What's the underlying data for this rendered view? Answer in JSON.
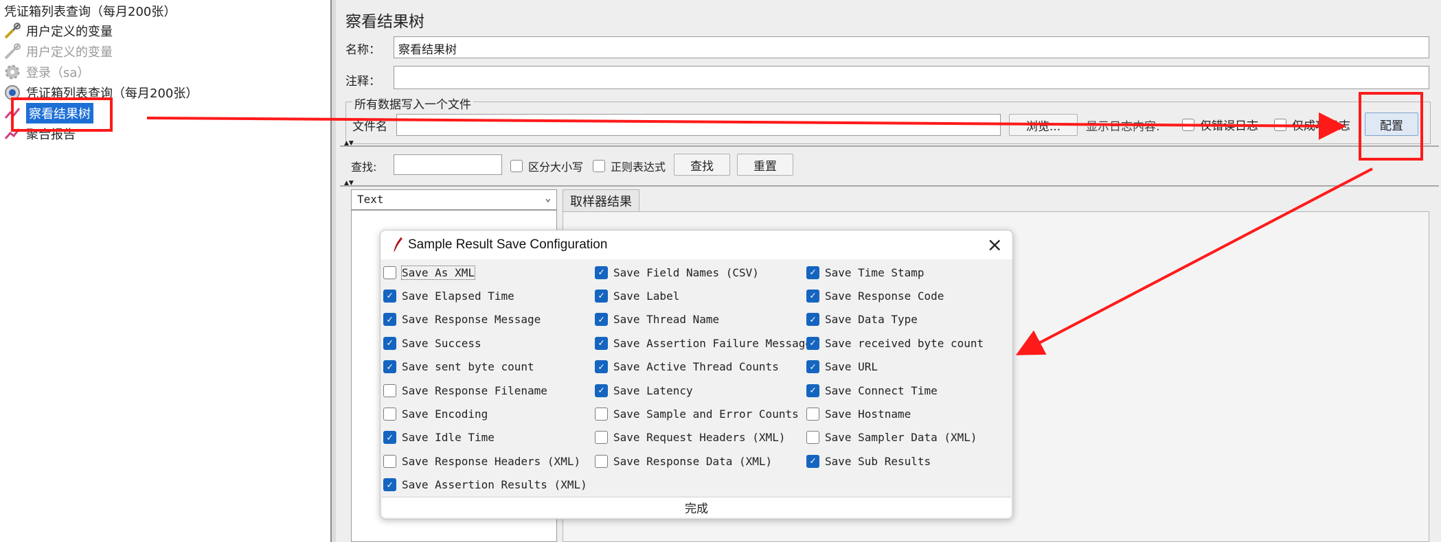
{
  "tree": {
    "items": [
      {
        "label": "凭证箱列表查询（每月200张）",
        "icon": "thread-group-icon",
        "disabled": false,
        "selected": false
      },
      {
        "label": "用户定义的变量",
        "icon": "wrench-icon",
        "disabled": false,
        "selected": false
      },
      {
        "label": "用户定义的变量",
        "icon": "wrench-icon",
        "disabled": true,
        "selected": false
      },
      {
        "label": "登录（sa）",
        "icon": "gear-icon",
        "disabled": true,
        "selected": false
      },
      {
        "label": "凭证箱列表查询（每月200张）",
        "icon": "sampler-icon",
        "disabled": false,
        "selected": false
      },
      {
        "label": "察看结果树",
        "icon": "listener-icon",
        "disabled": false,
        "selected": true
      },
      {
        "label": "聚合报告",
        "icon": "listener-icon",
        "disabled": false,
        "selected": false
      }
    ]
  },
  "main": {
    "title": "察看结果树",
    "name_label": "名称：",
    "name_value": "察看结果树",
    "comment_label": "注释：",
    "comment_value": "",
    "file_group_legend": "所有数据写入一个文件",
    "filename_label": "文件名",
    "filename_value": "",
    "browse_label": "浏览...",
    "log_content_label": "显示日志内容:",
    "errors_only_label": "仅错误日志",
    "success_only_label": "仅成功日志",
    "configure_label": "配置",
    "search_label": "查找:",
    "search_value": "",
    "case_sensitive_label": "区分大小写",
    "regex_label": "正则表达式",
    "find_button": "查找",
    "reset_button": "重置",
    "renderer_value": "Text",
    "tab_sampler_result": "取样器结果"
  },
  "dialog": {
    "title": "Sample Result Save Configuration",
    "done_label": "完成",
    "options": [
      {
        "label": "Save As XML",
        "checked": false
      },
      {
        "label": "Save Field Names (CSV)",
        "checked": true
      },
      {
        "label": "Save Time Stamp",
        "checked": true
      },
      {
        "label": "Save Elapsed Time",
        "checked": true
      },
      {
        "label": "Save Label",
        "checked": true
      },
      {
        "label": "Save Response Code",
        "checked": true
      },
      {
        "label": "Save Response Message",
        "checked": true
      },
      {
        "label": "Save Thread Name",
        "checked": true
      },
      {
        "label": "Save Data Type",
        "checked": true
      },
      {
        "label": "Save Success",
        "checked": true
      },
      {
        "label": "Save Assertion Failure Message",
        "checked": true
      },
      {
        "label": "Save received byte count",
        "checked": true
      },
      {
        "label": "Save sent byte count",
        "checked": true
      },
      {
        "label": "Save Active Thread Counts",
        "checked": true
      },
      {
        "label": "Save URL",
        "checked": true
      },
      {
        "label": "Save Response Filename",
        "checked": false
      },
      {
        "label": "Save Latency",
        "checked": true
      },
      {
        "label": "Save Connect Time",
        "checked": true
      },
      {
        "label": "Save Encoding",
        "checked": false
      },
      {
        "label": "Save Sample and Error Counts",
        "checked": false
      },
      {
        "label": "Save Hostname",
        "checked": false
      },
      {
        "label": "Save Idle Time",
        "checked": true
      },
      {
        "label": "Save Request Headers (XML)",
        "checked": false
      },
      {
        "label": "Save Sampler Data (XML)",
        "checked": false
      },
      {
        "label": "Save Response Headers (XML)",
        "checked": false
      },
      {
        "label": "Save Response Data (XML)",
        "checked": false
      },
      {
        "label": "Save Sub Results",
        "checked": true
      },
      {
        "label": "Save Assertion Results (XML)",
        "checked": true
      }
    ]
  },
  "colors": {
    "accent_checkbox": "#1565c0",
    "selection": "#1d6fd6",
    "annotation_red": "#ff1a1a"
  }
}
